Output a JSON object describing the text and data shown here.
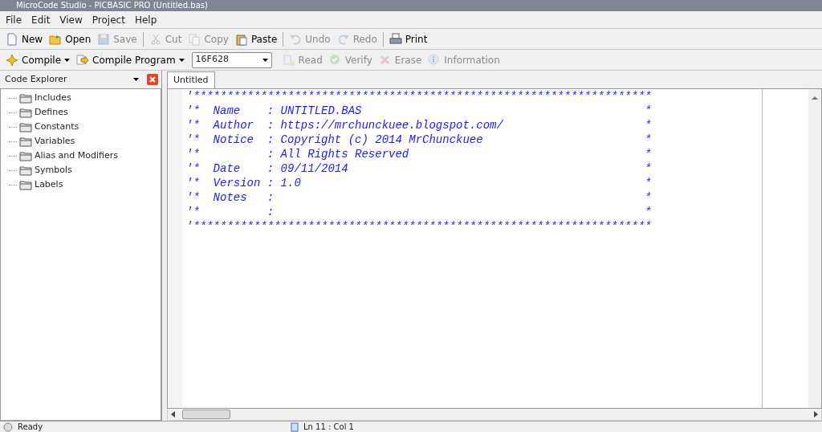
{
  "window": {
    "title": "MicroCode Studio - PICBASIC PRO (Untitled.bas)"
  },
  "menu": [
    "File",
    "Edit",
    "View",
    "Project",
    "Help"
  ],
  "toolbar": [
    {
      "label": "New",
      "disabled": false
    },
    {
      "label": "Open",
      "disabled": false
    },
    {
      "label": "Save",
      "disabled": true
    },
    {
      "label": "Cut",
      "disabled": true
    },
    {
      "label": "Copy",
      "disabled": true
    },
    {
      "label": "Paste",
      "disabled": false
    },
    {
      "label": "Undo",
      "disabled": true
    },
    {
      "label": "Redo",
      "disabled": true
    },
    {
      "label": "Print",
      "disabled": false
    }
  ],
  "toolbar2": {
    "compile": "Compile",
    "compile_program": "Compile Program",
    "device": "16F628",
    "actions": [
      {
        "label": "Read",
        "disabled": true
      },
      {
        "label": "Verify",
        "disabled": true
      },
      {
        "label": "Erase",
        "disabled": true
      },
      {
        "label": "Information",
        "disabled": true
      }
    ]
  },
  "explorer": {
    "title": "Code Explorer",
    "items": [
      "Includes",
      "Defines",
      "Constants",
      "Variables",
      "Alias and Modifiers",
      "Symbols",
      "Labels"
    ]
  },
  "tabs": [
    {
      "label": "Untitled",
      "selected": true
    }
  ],
  "code": [
    {
      "text": "'********************************************************************"
    },
    {
      "text": "'*  Name    : UNTITLED.BAS",
      "end": "*"
    },
    {
      "text": "'*  Author  : https://mrchunckuee.blogspot.com/",
      "end": "*"
    },
    {
      "text": "'*  Notice  : Copyright (c) 2014 MrChunckuee",
      "end": "*"
    },
    {
      "text": "'*          : All Rights Reserved",
      "end": "*"
    },
    {
      "text": "'*  Date    : 09/11/2014",
      "end": "*"
    },
    {
      "text": "'*  Version : 1.0",
      "end": "*"
    },
    {
      "text": "'*  Notes   :",
      "end": "*"
    },
    {
      "text": "'*          :",
      "end": "*"
    },
    {
      "text": "'********************************************************************"
    }
  ],
  "status_bar": {
    "message": "Ready",
    "position": "Ln 11 : Col 1"
  }
}
